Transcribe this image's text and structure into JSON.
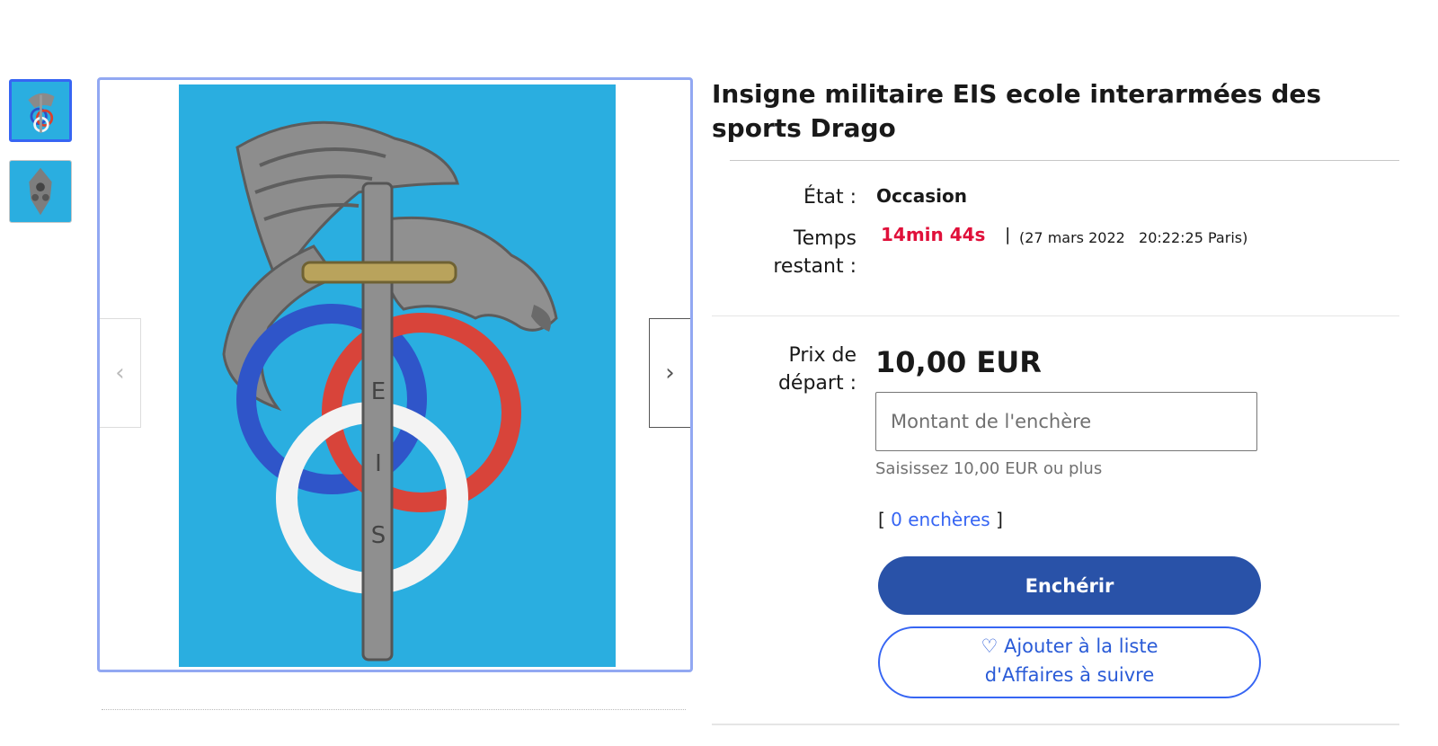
{
  "listing": {
    "title": "Insigne militaire EIS ecole interarmées des sports Drago"
  },
  "gallery": {
    "prev_icon": "‹",
    "next_icon": "›",
    "photo_background": "#2aaee0"
  },
  "details": {
    "condition_label": "État :",
    "condition_value": "Occasion",
    "time_label_line1": "Temps",
    "time_label_line2": "restant :",
    "time_left": "14min 44s",
    "separator": "|",
    "end_date": "(27 mars 2022   20:22:25 Paris)"
  },
  "pricing": {
    "price_label_line1": "Prix de",
    "price_label_line2": "départ :",
    "price": "10,00 EUR",
    "bid_placeholder": "Montant de l'enchère",
    "bid_hint": "Saisissez 10,00 EUR ou plus",
    "bids_open": "[ ",
    "bids_link": "0 enchères",
    "bids_close": " ]",
    "bid_button": "Enchérir",
    "watch_line1": "♡ Ajouter à la liste",
    "watch_line2": "d'Affaires à suivre"
  },
  "colors": {
    "accent": "#3665f3",
    "primary_button": "#2952a8",
    "countdown": "#e0103a"
  }
}
